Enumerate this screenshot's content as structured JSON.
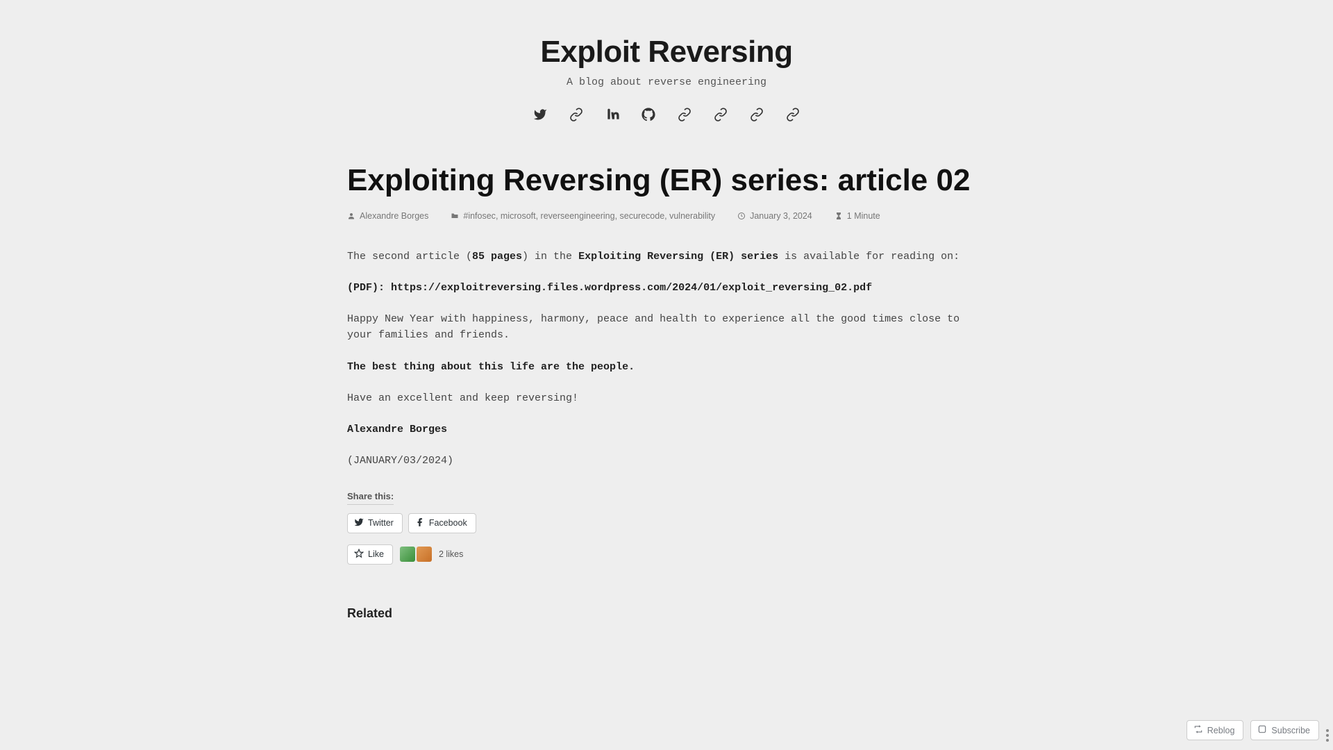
{
  "site": {
    "title": "Exploit Reversing",
    "tagline": "A blog about reverse engineering"
  },
  "social": [
    {
      "name": "twitter-icon"
    },
    {
      "name": "link-icon"
    },
    {
      "name": "linkedin-icon"
    },
    {
      "name": "github-icon"
    },
    {
      "name": "link-icon"
    },
    {
      "name": "link-icon"
    },
    {
      "name": "link-icon"
    },
    {
      "name": "link-icon"
    }
  ],
  "article": {
    "title": "Exploiting Reversing (ER) series: article 02",
    "author": "Alexandre Borges",
    "tags": [
      "#infosec",
      "microsoft",
      "reverseengineering",
      "securecode",
      "vulnerability"
    ],
    "date": "January 3, 2024",
    "read_time": "1 Minute",
    "body": {
      "p1_prefix": "The second article (",
      "p1_pages": "85 pages",
      "p1_mid": ") in the ",
      "p1_series": "Exploiting Reversing (ER) series",
      "p1_suffix": " is available for reading on:",
      "pdf_label": "(PDF): ",
      "pdf_url": "https://exploitreversing.files.wordpress.com/2024/01/exploit_reversing_02.pdf",
      "p3": "Happy New Year with happiness, harmony, peace and health to experience all the good times close to your families and friends.",
      "p4": "The best thing about this life are the people.",
      "p5": "Have an excellent and keep reversing!",
      "signature": "Alexandre Borges",
      "signature_date": "(JANUARY/03/2024)"
    }
  },
  "share": {
    "label": "Share this:",
    "buttons": {
      "twitter": "Twitter",
      "facebook": "Facebook"
    }
  },
  "likes": {
    "button": "Like",
    "count_text": "2 likes"
  },
  "related": {
    "heading": "Related"
  },
  "footer": {
    "reblog": "Reblog",
    "subscribe": "Subscribe"
  }
}
